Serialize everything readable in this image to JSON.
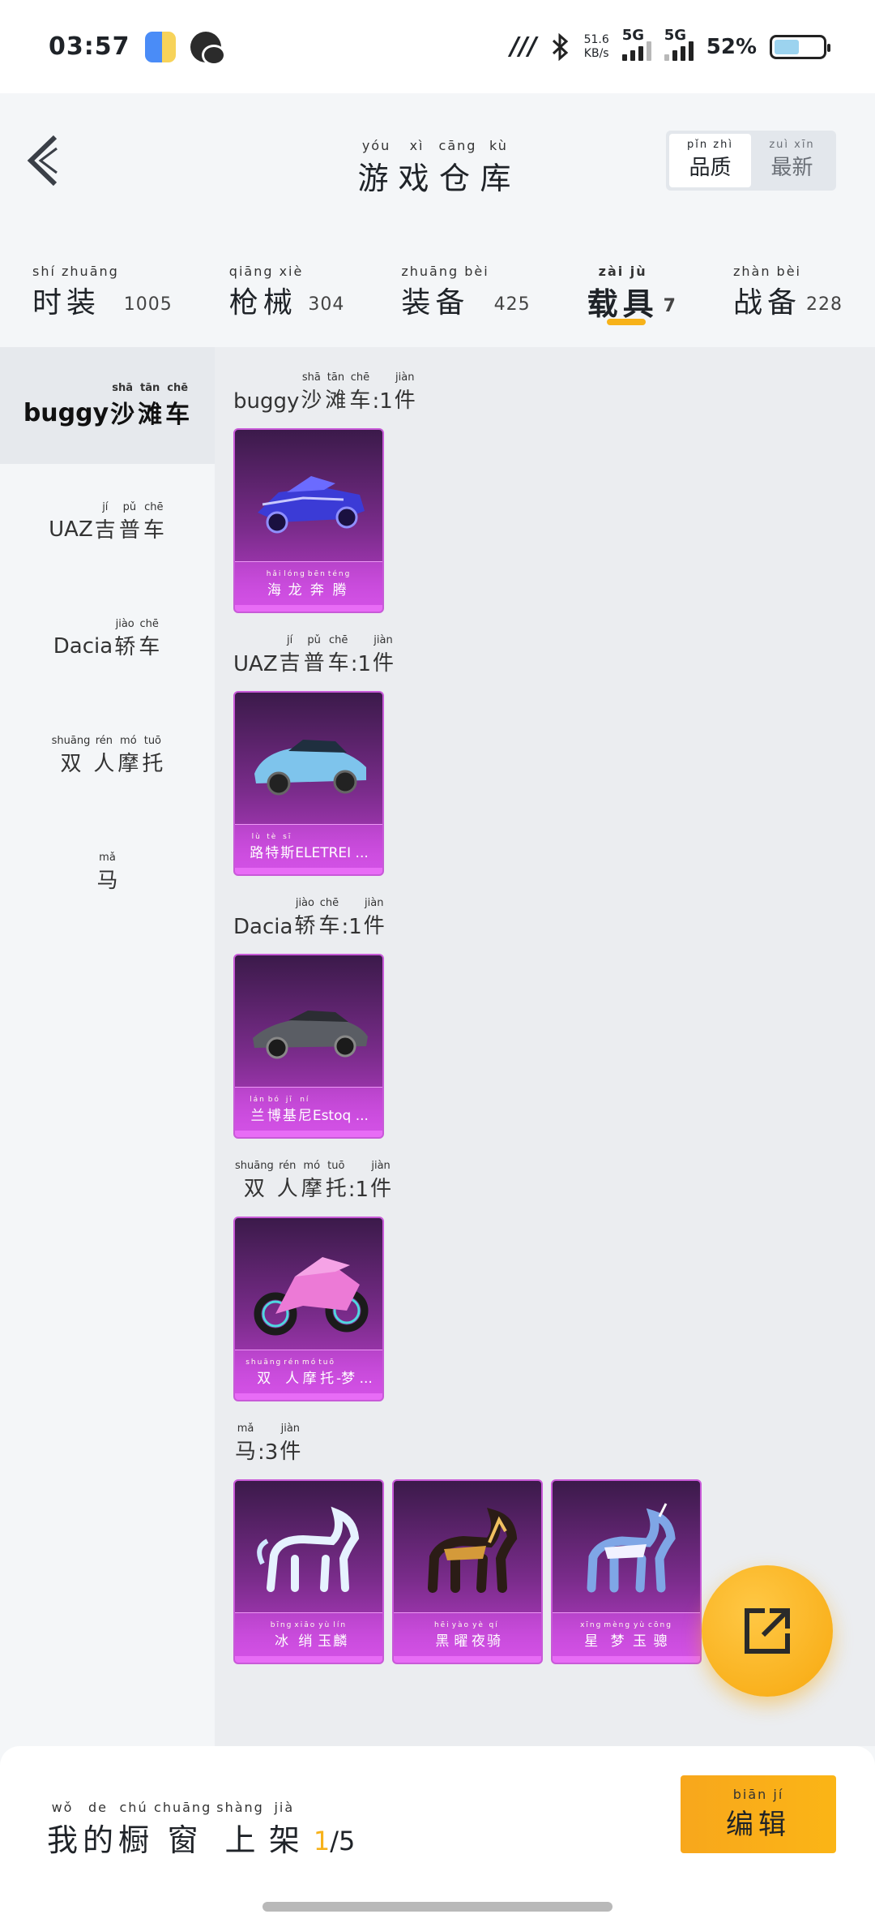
{
  "status_bar": {
    "time": "03:57",
    "net_speed_value": "51.6",
    "net_speed_unit": "KB/s",
    "signal1_label": "5G",
    "signal2_label": "5G",
    "battery_percent": "52%",
    "battery_level": 0.52,
    "icons": [
      "doc-app-icon",
      "wechat-icon",
      "m-icon",
      "bluetooth-icon"
    ]
  },
  "header": {
    "title_chars": [
      {
        "ch": "游",
        "py": "yóu"
      },
      {
        "ch": "戏",
        "py": "xì"
      },
      {
        "ch": "仓",
        "py": "cāng"
      },
      {
        "ch": "库",
        "py": "kù"
      }
    ],
    "sort_options": [
      {
        "label": "品质",
        "py": "pǐn  zhì",
        "active": true
      },
      {
        "label": "最新",
        "py": "zuì  xīn",
        "active": false
      }
    ]
  },
  "category_tabs": [
    {
      "label": "时装",
      "py": "shí  zhuāng",
      "count": "1005",
      "active": false
    },
    {
      "label": "枪械",
      "py": "qiāng  xiè",
      "count": "304",
      "active": false
    },
    {
      "label": "装备",
      "py": "zhuāng  bèi",
      "count": "425",
      "active": false
    },
    {
      "label": "载具",
      "py": "zài  jù",
      "count": "7",
      "active": true
    },
    {
      "label": "战备",
      "py": "zhàn  bèi",
      "count": "228",
      "active": false
    }
  ],
  "subnav": [
    {
      "prefix": "buggy",
      "chars": [
        {
          "ch": "沙",
          "py": "shā"
        },
        {
          "ch": "滩",
          "py": "tān"
        },
        {
          "ch": "车",
          "py": "chē"
        }
      ],
      "active": true
    },
    {
      "prefix": "UAZ",
      "chars": [
        {
          "ch": "吉",
          "py": "jí"
        },
        {
          "ch": "普",
          "py": "pǔ"
        },
        {
          "ch": "车",
          "py": "chē"
        }
      ],
      "active": false
    },
    {
      "prefix": "Dacia",
      "chars": [
        {
          "ch": "轿",
          "py": "jiào"
        },
        {
          "ch": "车",
          "py": "chē"
        }
      ],
      "active": false
    },
    {
      "prefix": "",
      "chars": [
        {
          "ch": "双",
          "py": "shuāng"
        },
        {
          "ch": "人",
          "py": "rén"
        },
        {
          "ch": "摩",
          "py": "mó"
        },
        {
          "ch": "托",
          "py": "tuō"
        }
      ],
      "active": false
    },
    {
      "prefix": "",
      "chars": [
        {
          "ch": "马",
          "py": "mǎ"
        }
      ],
      "active": false
    }
  ],
  "groups": [
    {
      "prefix": "buggy",
      "chars": [
        {
          "ch": "沙",
          "py": "shā"
        },
        {
          "ch": "滩",
          "py": "tān"
        },
        {
          "ch": "车",
          "py": "chē"
        }
      ],
      "count_text": ":1",
      "unit": {
        "ch": "件",
        "py": "jiàn"
      },
      "items": [
        {
          "art": "buggy",
          "chars": [
            {
              "ch": "海",
              "py": "hǎi"
            },
            {
              "ch": "龙",
              "py": "lóng"
            },
            {
              "ch": "奔",
              "py": "bēn"
            },
            {
              "ch": "腾",
              "py": "téng"
            }
          ],
          "suffix": ""
        }
      ]
    },
    {
      "prefix": "UAZ",
      "chars": [
        {
          "ch": "吉",
          "py": "jí"
        },
        {
          "ch": "普",
          "py": "pǔ"
        },
        {
          "ch": "车",
          "py": "chē"
        }
      ],
      "count_text": ":1",
      "unit": {
        "ch": "件",
        "py": "jiàn"
      },
      "items": [
        {
          "art": "suv",
          "chars": [
            {
              "ch": "路",
              "py": "lù"
            },
            {
              "ch": "特",
              "py": "tè"
            },
            {
              "ch": "斯",
              "py": "sī"
            }
          ],
          "suffix": "ELETREI ..."
        }
      ]
    },
    {
      "prefix": "Dacia",
      "chars": [
        {
          "ch": "轿",
          "py": "jiào"
        },
        {
          "ch": "车",
          "py": "chē"
        }
      ],
      "count_text": ":1",
      "unit": {
        "ch": "件",
        "py": "jiàn"
      },
      "items": [
        {
          "art": "sedan",
          "chars": [
            {
              "ch": "兰",
              "py": "lán"
            },
            {
              "ch": "博",
              "py": "bó"
            },
            {
              "ch": "基",
              "py": "jī"
            },
            {
              "ch": "尼",
              "py": "ní"
            }
          ],
          "suffix": "Estoq ..."
        }
      ]
    },
    {
      "prefix": "",
      "chars": [
        {
          "ch": "双",
          "py": "shuāng"
        },
        {
          "ch": "人",
          "py": "rén"
        },
        {
          "ch": "摩",
          "py": "mó"
        },
        {
          "ch": "托",
          "py": "tuō"
        }
      ],
      "count_text": ":1",
      "unit": {
        "ch": "件",
        "py": "jiàn"
      },
      "items": [
        {
          "art": "moto",
          "chars": [
            {
              "ch": "双",
              "py": "shuāng"
            },
            {
              "ch": "人",
              "py": "rén"
            },
            {
              "ch": "摩",
              "py": "mó"
            },
            {
              "ch": "托",
              "py": "tuō"
            }
          ],
          "suffix": "-梦 ..."
        }
      ]
    },
    {
      "prefix": "",
      "chars": [
        {
          "ch": "马",
          "py": "mǎ"
        }
      ],
      "count_text": ":3",
      "unit": {
        "ch": "件",
        "py": "jiàn"
      },
      "items": [
        {
          "art": "horse-ice",
          "chars": [
            {
              "ch": "冰",
              "py": "bīng"
            },
            {
              "ch": "绡",
              "py": "xiāo"
            },
            {
              "ch": "玉",
              "py": "yù"
            },
            {
              "ch": "麟",
              "py": "lín"
            }
          ],
          "suffix": ""
        },
        {
          "art": "horse-dark",
          "chars": [
            {
              "ch": "黑",
              "py": "hēi"
            },
            {
              "ch": "曜",
              "py": "yào"
            },
            {
              "ch": "夜",
              "py": "yè"
            },
            {
              "ch": "骑",
              "py": "qí"
            }
          ],
          "suffix": ""
        },
        {
          "art": "horse-star",
          "chars": [
            {
              "ch": "星",
              "py": "xīng"
            },
            {
              "ch": "梦",
              "py": "mèng"
            },
            {
              "ch": "玉",
              "py": "yù"
            },
            {
              "ch": "骢",
              "py": "cōng"
            }
          ],
          "suffix": ""
        }
      ]
    }
  ],
  "bottom_bar": {
    "chars": [
      {
        "ch": "我",
        "py": "wǒ"
      },
      {
        "ch": "的",
        "py": "de"
      },
      {
        "ch": "橱",
        "py": "chú"
      },
      {
        "ch": "窗",
        "py": "chuāng"
      },
      {
        "ch": "上",
        "py": "shàng"
      },
      {
        "ch": "架",
        "py": "jià"
      }
    ],
    "current": "1",
    "total": "/5",
    "edit_label": "编辑",
    "edit_py": "biān  jí"
  },
  "colors": {
    "accent": "#f7b21a",
    "card_purple": "#7b2c8c",
    "card_magenta": "#d352e6"
  }
}
